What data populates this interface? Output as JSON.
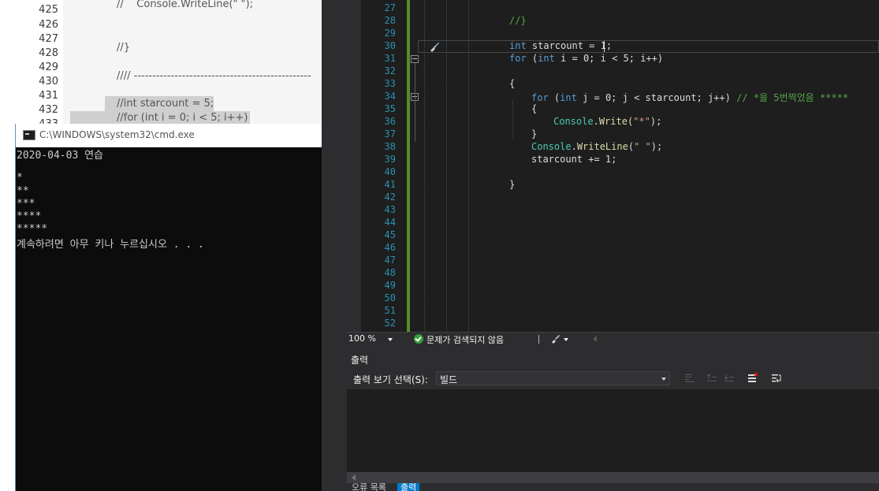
{
  "background_editor": {
    "lines": [
      {
        "num": "425",
        "text": "//    Console.WriteLine(\" \");"
      },
      {
        "num": "426",
        "text": ""
      },
      {
        "num": "427",
        "text": ""
      },
      {
        "num": "428",
        "text": "//}"
      },
      {
        "num": "429",
        "text": ""
      },
      {
        "num": "430",
        "text": "//// ------------------------------------------------"
      },
      {
        "num": "431",
        "text": "//int starcount = 5;"
      },
      {
        "num": "432",
        "text": "//for (int i = 0; i < 5; i++)"
      },
      {
        "num": "433",
        "text": ""
      }
    ]
  },
  "cmd": {
    "title": "C:\\WINDOWS\\system32\\cmd.exe",
    "lines": [
      "2020-04-03 연습",
      "",
      "*",
      "**",
      "***",
      "****",
      "*****",
      "계속하려면 아무 키나 누르십시오 . . ."
    ]
  },
  "editor": {
    "line_numbers": [
      "27",
      "28",
      "29",
      "30",
      "31",
      "32",
      "33",
      "34",
      "35",
      "36",
      "37",
      "38",
      "39",
      "40",
      "41",
      "42",
      "43",
      "44",
      "45",
      "46",
      "47",
      "48",
      "49",
      "50",
      "51",
      "52"
    ],
    "code": {
      "l28": "//}",
      "l30_kw": "int",
      "l30_rest": " starcount = 1;",
      "l31_kw": "for",
      "l31_a": " (",
      "l31_int": "int",
      "l31_b": " i = 0; i < 5; i++)",
      "l33": "{",
      "l34_kw": "for",
      "l34_a": " (",
      "l34_int": "int",
      "l34_b": " j = 0; j < starcount; j++) ",
      "l34_comment": "// *을 5번찍었음 *****",
      "l35": "{",
      "l36_ty": "Console",
      "l36_dot": ".",
      "l36_fn": "Write",
      "l36_a": "(",
      "l36_str": "\"*\"",
      "l36_b": ");",
      "l37": "}",
      "l38_ty": "Console",
      "l38_dot": ".",
      "l38_fn": "WriteLine",
      "l38_a": "(",
      "l38_str": "\" \"",
      "l38_b": ");",
      "l39": "starcount += 1;",
      "l41": "}"
    }
  },
  "status": {
    "zoom": "100 %",
    "issues": "문제가 검색되지 않음"
  },
  "output": {
    "title": "출력",
    "source_label": "출력 보기 선택(S):",
    "source_value": "빌드"
  },
  "bottom_tabs": {
    "errors": "오류 목록",
    "output": "출력"
  },
  "colors": {
    "editor_bg": "#1e1e1e",
    "keyword": "#569cd6",
    "comment": "#57a64a",
    "string": "#d69d85",
    "type": "#4ec9b0",
    "method": "#dcdcaa",
    "line_number": "#2b91af",
    "change_bar": "#5c8c2a",
    "accent": "#007acc"
  }
}
